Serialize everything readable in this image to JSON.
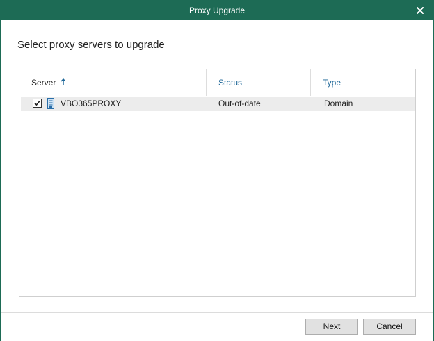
{
  "window": {
    "title": "Proxy Upgrade",
    "close_icon": "close-icon",
    "titlebar_color": "#1d6b55"
  },
  "page": {
    "heading": "Select proxy servers to upgrade"
  },
  "grid": {
    "columns": [
      {
        "label": "Server",
        "sort": "ascending",
        "sort_icon": "arrow-up-icon",
        "color": "#222222"
      },
      {
        "label": "Status",
        "color": "#1a6496"
      },
      {
        "label": "Type",
        "color": "#1a6496"
      }
    ],
    "rows": [
      {
        "checked": true,
        "icon": "server-icon",
        "server": "VBO365PROXY",
        "status": "Out-of-date",
        "type": "Domain"
      }
    ]
  },
  "footer": {
    "next_label": "Next",
    "cancel_label": "Cancel"
  }
}
